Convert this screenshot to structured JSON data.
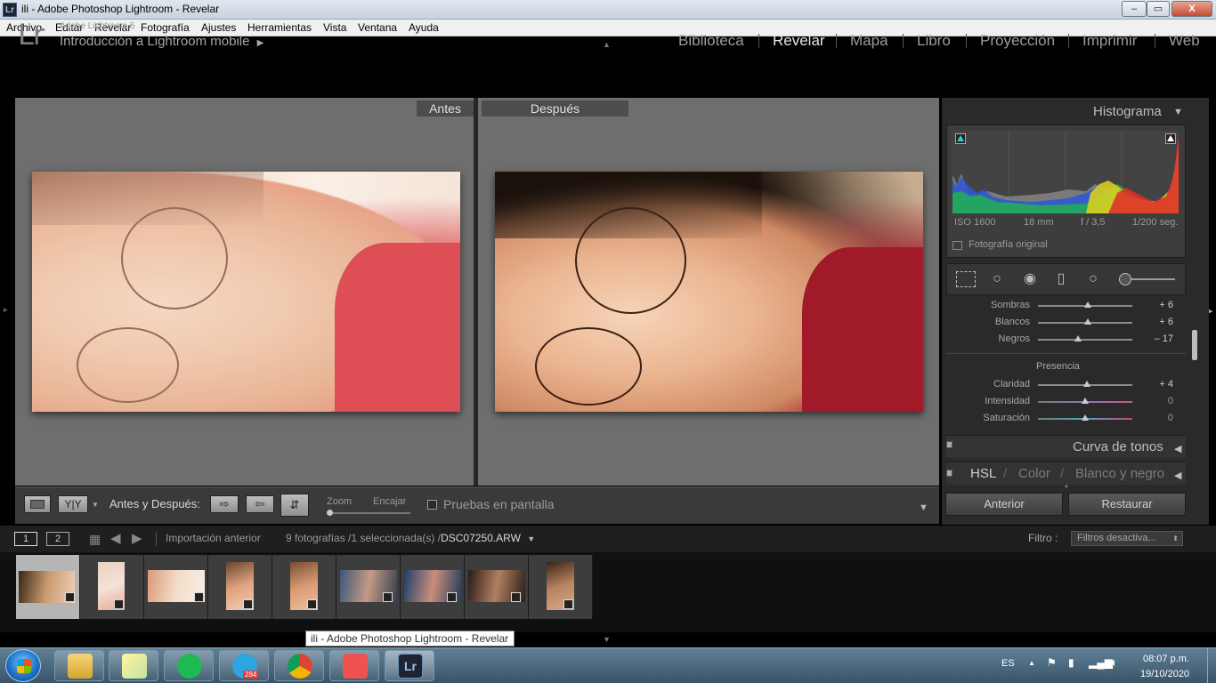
{
  "window": {
    "title": "ili - Adobe Photoshop Lightroom - Revelar",
    "controls": {
      "minimize": "–",
      "maximize": "▭",
      "close": "X"
    }
  },
  "menu": [
    "Archivo",
    "Editar",
    "Revelar",
    "Fotografía",
    "Ajustes",
    "Herramientas",
    "Vista",
    "Ventana",
    "Ayuda"
  ],
  "header": {
    "logo": "Lr",
    "version": "Adobe Lightroom 5",
    "identity": "Introducción a Lightroom mobile",
    "identity_arrow": "▶",
    "modules": [
      "Biblioteca",
      "Revelar",
      "Mapa",
      "Libro",
      "Proyección",
      "Imprimir",
      "Web"
    ],
    "active_module": "Revelar"
  },
  "view": {
    "before_label": "Antes",
    "after_label": "Después"
  },
  "toolbar": {
    "yy": "Y|Y",
    "before_after_label": "Antes y Después:",
    "zoom": "Zoom",
    "encajar": "Encajar",
    "pruebas": "Pruebas en pantalla",
    "dropdown": "▼"
  },
  "histogram": {
    "title": "Histograma",
    "iso": "ISO 1600",
    "focal": "18 mm",
    "aperture": "f / 3,5",
    "shutter": "1/200 seg.",
    "original_photo": "Fotografía original"
  },
  "basic": {
    "sliders": [
      {
        "label": "Sombras",
        "value": "+ 6",
        "pos": 0.53
      },
      {
        "label": "Blancos",
        "value": "+ 6",
        "pos": 0.53
      },
      {
        "label": "Negros",
        "value": "– 17",
        "pos": 0.42
      }
    ],
    "presence_title": "Presencia",
    "presence": [
      {
        "label": "Claridad",
        "value": "+ 4",
        "pos": 0.52
      },
      {
        "label": "Intensidad",
        "value": "0",
        "pos": 0.5
      },
      {
        "label": "Saturación",
        "value": "0",
        "pos": 0.5
      }
    ]
  },
  "panels": {
    "curve": "Curva de tonos",
    "hsl": "HSL",
    "color": "Color",
    "bw": "Blanco y negro",
    "slash": "/"
  },
  "buttons": {
    "previous": "Anterior",
    "reset": "Restaurar"
  },
  "filmstrip": {
    "view1": "1",
    "view2": "2",
    "source": "Importación anterior",
    "count": "9 fotografías /1 seleccionada(s) /",
    "file": "DSC07250.ARW",
    "filter_label": "Filtro :",
    "filter_value": "Filtros desactiva..."
  },
  "tooltip": "ili - Adobe Photoshop Lightroom - Revelar",
  "taskbar": {
    "lang": "ES",
    "time": "08:07 p.m.",
    "date": "19/10/2020",
    "telegram_badge": "284",
    "lr_app": "Lr"
  }
}
